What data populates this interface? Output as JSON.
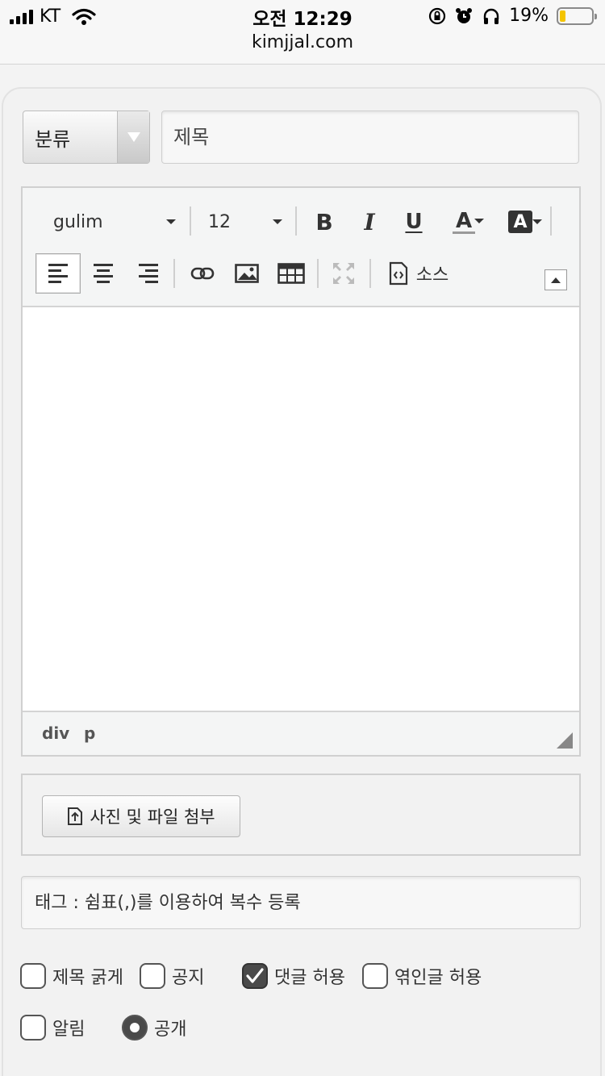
{
  "status_bar": {
    "carrier": "KT",
    "time": "오전 12:29",
    "url": "kimjjal.com",
    "battery_percent": "19%",
    "battery_level": 0.19,
    "battery_color": "#f4c400"
  },
  "form": {
    "category_label": "분류",
    "title_placeholder": "제목",
    "tag_placeholder": "태그 : 쉼표(,)를 이용하여 복수 등록"
  },
  "editor": {
    "font_name": "gulim",
    "font_size": "12",
    "bold_label": "B",
    "italic_label": "I",
    "underline_label": "U",
    "font_color_label": "A",
    "bg_color_label": "A",
    "source_label": "소스",
    "path_items": [
      "div",
      "p"
    ]
  },
  "attach": {
    "button_label": "사진 및 파일 첨부"
  },
  "options": {
    "bold_title": {
      "label": "제목 굵게",
      "checked": false
    },
    "notice": {
      "label": "공지",
      "checked": false
    },
    "allow_comments": {
      "label": "댓글 허용",
      "checked": true
    },
    "allow_replies": {
      "label": "엮인글 허용",
      "checked": false
    },
    "alert": {
      "label": "알림",
      "checked": false
    },
    "public": {
      "label": "공개",
      "checked": true
    }
  }
}
